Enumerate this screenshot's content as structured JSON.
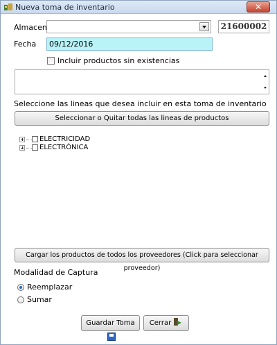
{
  "window": {
    "title": "Nueva toma de inventario",
    "close_label": "✕"
  },
  "form": {
    "almacen_label": "Almacen",
    "almacen_value": "",
    "code": "21600002",
    "fecha_label": "Fecha",
    "fecha_value": "09/12/2016",
    "include_no_stock_label": "Incluir productos sin existencias",
    "include_no_stock_checked": false,
    "memo_value": ""
  },
  "lines": {
    "instruction": "Seleccione las lineas que desea incluir en esta toma de inventario",
    "toggle_all_button": "Seleccionar o Quitar todas las lineas de productos",
    "items": [
      {
        "label": "ELECTRICIDAD",
        "checked": false
      },
      {
        "label": "ELECTRÓNICA",
        "checked": false
      }
    ]
  },
  "providers_button": "Cargar los productos de todos los proveedores (Click para seleccionar proveedor)",
  "capture": {
    "title": "Modalidad de Captura",
    "options": [
      {
        "label": "Reemplazar",
        "selected": true
      },
      {
        "label": "Sumar",
        "selected": false
      }
    ]
  },
  "actions": {
    "save_label": "Guardar Toma",
    "close_label": "Cerrar"
  },
  "colors": {
    "date_bg": "#b9f3f7",
    "close_btn": "#c7432c",
    "titlebar": "#dfe9f5"
  }
}
